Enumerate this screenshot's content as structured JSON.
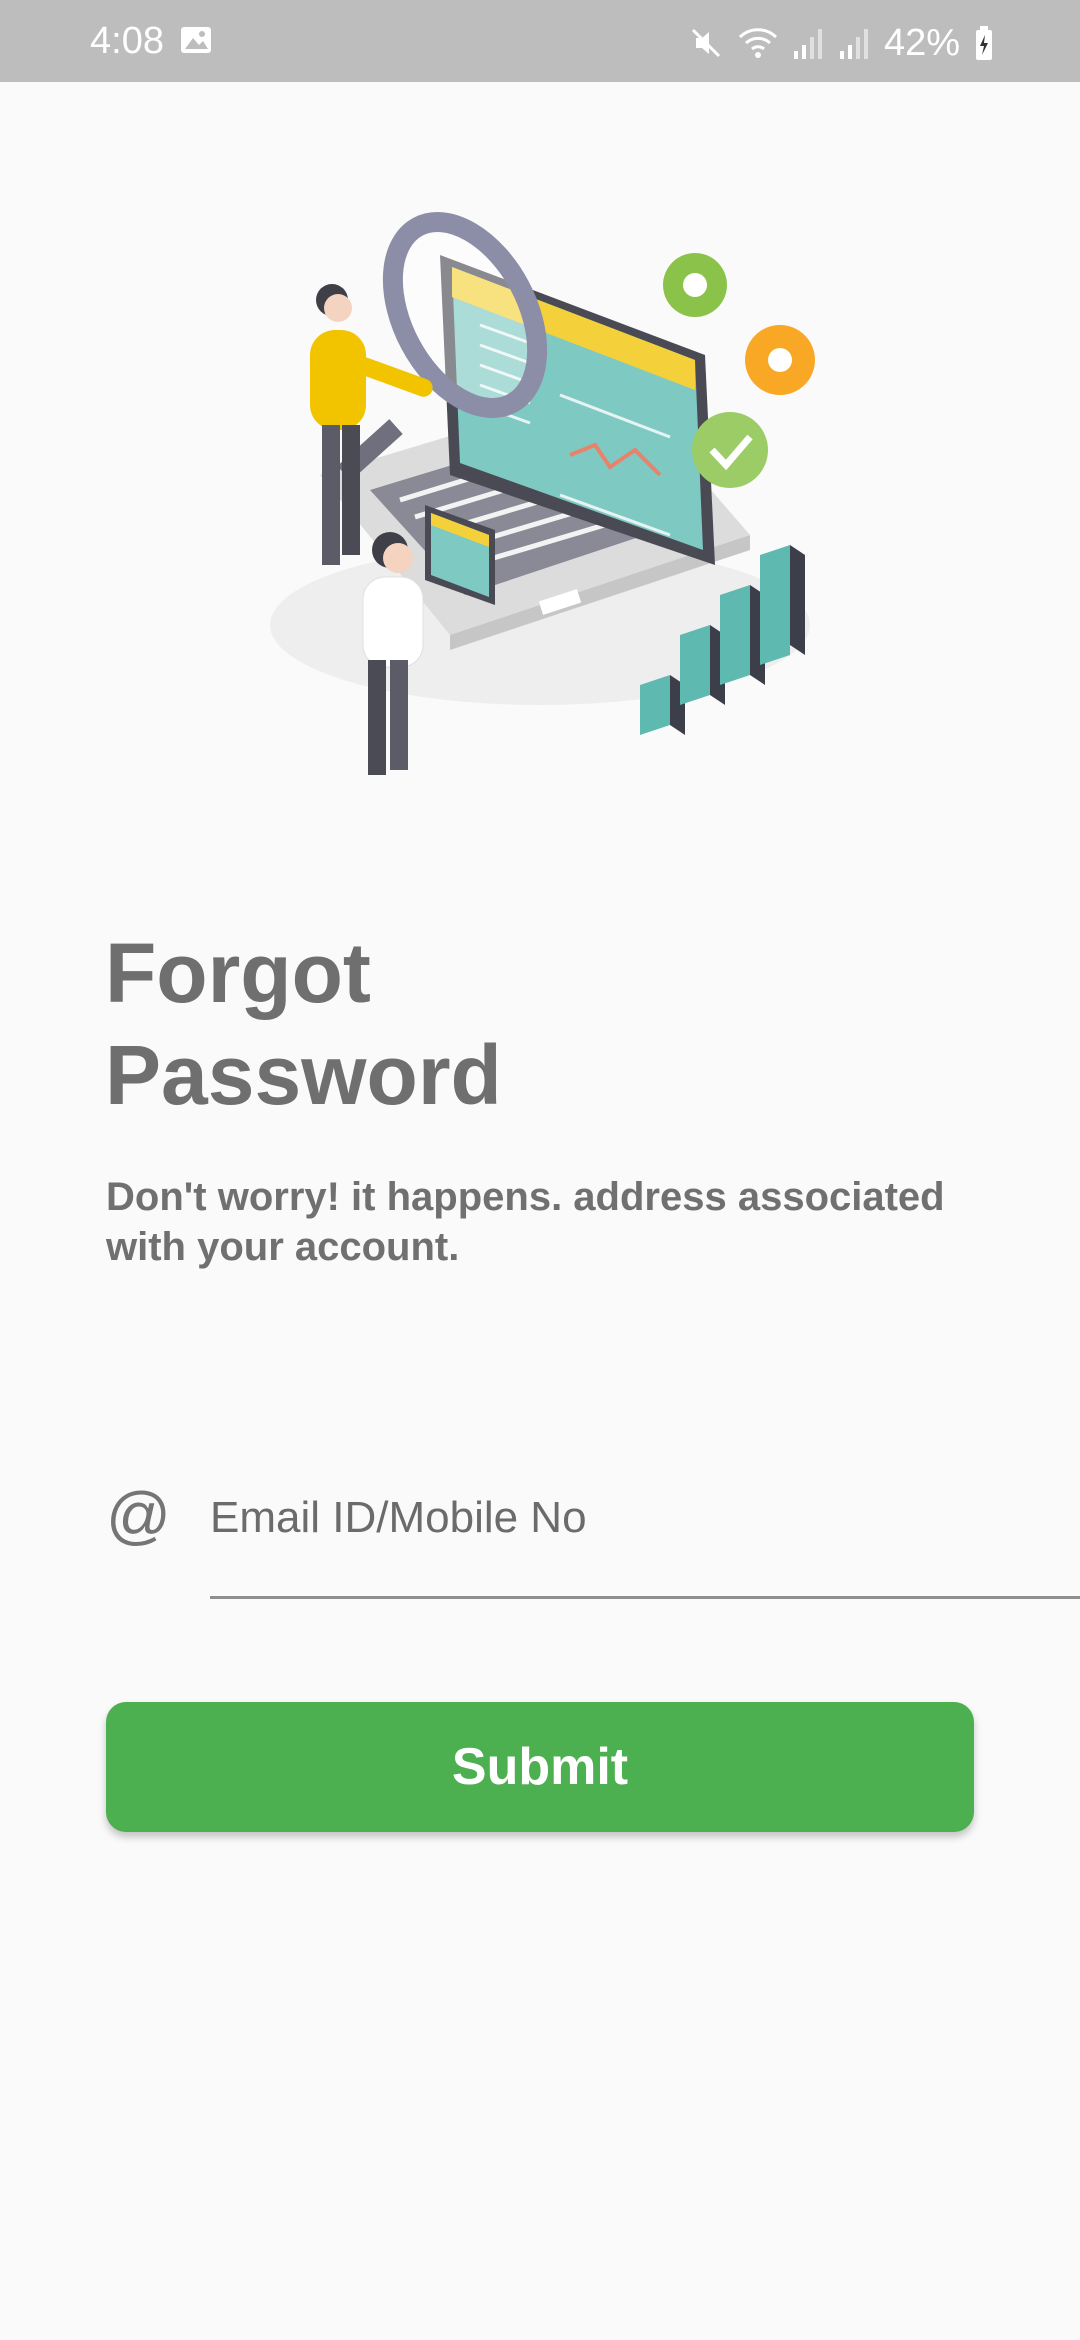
{
  "status_bar": {
    "time": "4:08",
    "battery": "42%",
    "icons": [
      "gallery-icon",
      "mute-icon",
      "wifi-icon",
      "signal-icon",
      "signal-icon",
      "battery-charging-icon"
    ]
  },
  "illustration": {
    "icon": "forgot-password-illustration"
  },
  "page": {
    "title_line1": "Forgot",
    "title_line2": "Password",
    "subtitle": "Don't worry! it happens. address associated with your account."
  },
  "form": {
    "email_icon": "@",
    "email_placeholder": "Email ID/Mobile No",
    "email_value": "",
    "submit_label": "Submit"
  },
  "colors": {
    "primary": "#4caf50",
    "status_bar": "#bdbdbd",
    "title_text": "#6f6f6f",
    "background": "#fafafa"
  }
}
